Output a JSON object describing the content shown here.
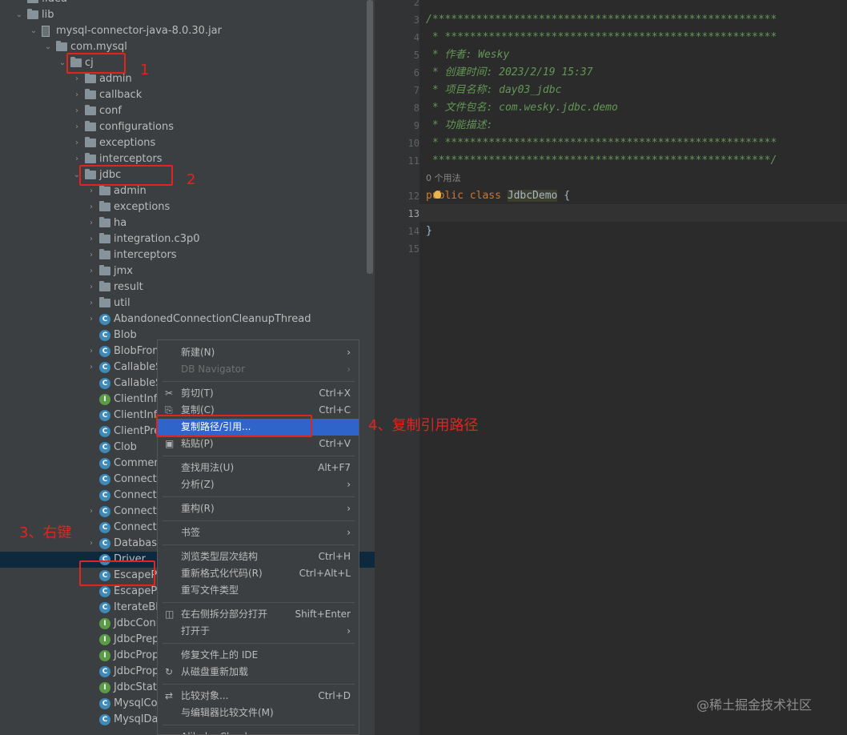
{
  "tree": {
    "rows": [
      {
        "label": ".idea",
        "kind": "folder",
        "arrow": "right"
      },
      {
        "label": "lib",
        "kind": "folder",
        "arrow": "down"
      },
      {
        "label": "mysql-connector-java-8.0.30.jar",
        "kind": "jar",
        "arrow": "down"
      },
      {
        "label": "com.mysql",
        "kind": "folder",
        "arrow": "down"
      },
      {
        "label": "cj",
        "kind": "folder",
        "arrow": "down"
      },
      {
        "label": "admin",
        "kind": "folder",
        "arrow": "right"
      },
      {
        "label": "callback",
        "kind": "folder",
        "arrow": "right"
      },
      {
        "label": "conf",
        "kind": "folder",
        "arrow": "right"
      },
      {
        "label": "configurations",
        "kind": "folder",
        "arrow": "right"
      },
      {
        "label": "exceptions",
        "kind": "folder",
        "arrow": "right"
      },
      {
        "label": "interceptors",
        "kind": "folder",
        "arrow": "right"
      },
      {
        "label": "jdbc",
        "kind": "folder",
        "arrow": "down"
      },
      {
        "label": "admin",
        "kind": "folder",
        "arrow": "right"
      },
      {
        "label": "exceptions",
        "kind": "folder",
        "arrow": "right"
      },
      {
        "label": "ha",
        "kind": "folder",
        "arrow": "right"
      },
      {
        "label": "integration.c3p0",
        "kind": "folder",
        "arrow": "right"
      },
      {
        "label": "interceptors",
        "kind": "folder",
        "arrow": "right"
      },
      {
        "label": "jmx",
        "kind": "folder",
        "arrow": "right"
      },
      {
        "label": "result",
        "kind": "folder",
        "arrow": "right"
      },
      {
        "label": "util",
        "kind": "folder",
        "arrow": "right"
      },
      {
        "label": "AbandonedConnectionCleanupThread",
        "kind": "class",
        "arrow": "right"
      },
      {
        "label": "Blob",
        "kind": "class",
        "arrow": ""
      },
      {
        "label": "BlobFrom",
        "kind": "class",
        "arrow": "right"
      },
      {
        "label": "CallableS",
        "kind": "class",
        "arrow": "right"
      },
      {
        "label": "CallableS",
        "kind": "class",
        "arrow": ""
      },
      {
        "label": "ClientInfo",
        "kind": "interface",
        "arrow": ""
      },
      {
        "label": "ClientInfo",
        "kind": "class",
        "arrow": ""
      },
      {
        "label": "ClientPrep",
        "kind": "class",
        "arrow": ""
      },
      {
        "label": "Clob",
        "kind": "class",
        "arrow": ""
      },
      {
        "label": "Comment",
        "kind": "class",
        "arrow": ""
      },
      {
        "label": "Connectio",
        "kind": "class",
        "arrow": ""
      },
      {
        "label": "Connectio",
        "kind": "class",
        "arrow": ""
      },
      {
        "label": "Connectio",
        "kind": "class",
        "arrow": "right"
      },
      {
        "label": "Connectio",
        "kind": "class",
        "arrow": ""
      },
      {
        "label": "Database",
        "kind": "class",
        "arrow": "right"
      },
      {
        "label": "Driver",
        "kind": "class",
        "arrow": "",
        "selected": true
      },
      {
        "label": "EscapePro",
        "kind": "class",
        "arrow": ""
      },
      {
        "label": "EscapePro",
        "kind": "class",
        "arrow": ""
      },
      {
        "label": "IterateBlo",
        "kind": "class",
        "arrow": ""
      },
      {
        "label": "JdbcConn",
        "kind": "interface",
        "arrow": ""
      },
      {
        "label": "JdbcPrep",
        "kind": "interface",
        "arrow": ""
      },
      {
        "label": "JdbcProp",
        "kind": "interface",
        "arrow": ""
      },
      {
        "label": "JdbcProp",
        "kind": "class",
        "arrow": ""
      },
      {
        "label": "JdbcState",
        "kind": "interface",
        "arrow": ""
      },
      {
        "label": "MysqlCon",
        "kind": "class",
        "arrow": ""
      },
      {
        "label": "MysqlDat",
        "kind": "class",
        "arrow": ""
      }
    ]
  },
  "editor": {
    "lines": [
      {
        "num": "2",
        "parts": []
      },
      {
        "num": "3",
        "parts": [
          {
            "t": "/*******************************************************",
            "c": "cmt"
          }
        ]
      },
      {
        "num": "4",
        "parts": [
          {
            "t": " * *****************************************************",
            "c": "cmt"
          }
        ]
      },
      {
        "num": "5",
        "parts": [
          {
            "t": " * 作者: Wesky",
            "c": "cmt"
          }
        ]
      },
      {
        "num": "6",
        "parts": [
          {
            "t": " * 创建时间: 2023/2/19 15:37",
            "c": "cmt"
          }
        ]
      },
      {
        "num": "7",
        "parts": [
          {
            "t": " * 项目名称: day03_jdbc",
            "c": "cmt"
          }
        ]
      },
      {
        "num": "8",
        "parts": [
          {
            "t": " * 文件包名: com.wesky.jdbc.demo",
            "c": "cmt"
          }
        ]
      },
      {
        "num": "9",
        "parts": [
          {
            "t": " * 功能描述:",
            "c": "cmt"
          }
        ]
      },
      {
        "num": "10",
        "parts": [
          {
            "t": " * *****************************************************",
            "c": "cmt"
          }
        ]
      },
      {
        "num": "11",
        "parts": [
          {
            "t": " ******************************************************/",
            "c": "cmt"
          }
        ]
      },
      {
        "num": "",
        "hint": "0 个用法"
      },
      {
        "num": "12",
        "parts": [
          {
            "t": "public class ",
            "c": "kw"
          },
          {
            "t": "JdbcDemo",
            "c": "cls-name"
          },
          {
            "t": " {",
            "c": ""
          }
        ]
      },
      {
        "num": "13",
        "parts": [],
        "current": true
      },
      {
        "num": "14",
        "parts": [
          {
            "t": "}",
            "c": ""
          }
        ]
      },
      {
        "num": "15",
        "parts": []
      }
    ]
  },
  "context_menu": {
    "items": [
      {
        "label": "新建(N)",
        "submenu": true
      },
      {
        "label": "DB Navigator",
        "submenu": true,
        "disabled": true
      },
      {
        "sep": true
      },
      {
        "label": "剪切(T)",
        "shortcut": "Ctrl+X",
        "icon": "✂",
        "icon_name": "scissors-icon"
      },
      {
        "label": "复制(C)",
        "shortcut": "Ctrl+C",
        "icon": "⎘",
        "icon_name": "copy-icon"
      },
      {
        "label": "复制路径/引用...",
        "highlighted": true
      },
      {
        "label": "粘贴(P)",
        "shortcut": "Ctrl+V",
        "icon": "▣",
        "icon_name": "paste-icon"
      },
      {
        "sep": true
      },
      {
        "label": "查找用法(U)",
        "shortcut": "Alt+F7"
      },
      {
        "label": "分析(Z)",
        "submenu": true
      },
      {
        "sep": true
      },
      {
        "label": "重构(R)",
        "submenu": true
      },
      {
        "sep": true
      },
      {
        "label": "书签",
        "submenu": true
      },
      {
        "sep": true
      },
      {
        "label": "浏览类型层次结构",
        "shortcut": "Ctrl+H"
      },
      {
        "label": "重新格式化代码(R)",
        "shortcut": "Ctrl+Alt+L"
      },
      {
        "label": "重写文件类型"
      },
      {
        "sep": true
      },
      {
        "label": "在右侧拆分部分打开",
        "shortcut": "Shift+Enter",
        "icon": "◫",
        "icon_name": "split-icon"
      },
      {
        "label": "打开于",
        "submenu": true
      },
      {
        "sep": true
      },
      {
        "label": "修复文件上的 IDE"
      },
      {
        "label": "从磁盘重新加载",
        "icon": "↻",
        "icon_name": "reload-icon"
      },
      {
        "sep": true
      },
      {
        "label": "比较对象...",
        "shortcut": "Ctrl+D",
        "icon": "⇄",
        "icon_name": "compare-icon"
      },
      {
        "label": "与编辑器比较文件(M)"
      },
      {
        "sep": true
      },
      {
        "label": "Alibaba Cloud",
        "submenu": true
      }
    ]
  },
  "annotations": {
    "a1": "1",
    "a2": "2",
    "a3": "3、右键",
    "a4": "4、复制引用路径"
  },
  "watermark": "@稀土掘金技术社区",
  "colors": {
    "annotation": "#e0251f",
    "selection": "#2f65ca",
    "comment": "#629755",
    "keyword": "#cc7832"
  }
}
